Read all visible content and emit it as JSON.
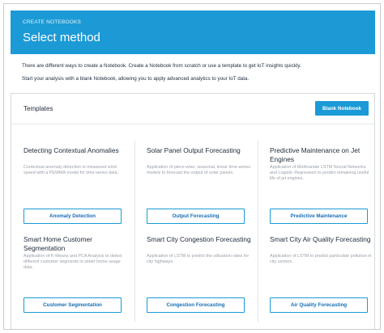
{
  "header": {
    "breadcrumb": "CREATE NOTEBOOKS",
    "title": "Select method"
  },
  "intro": {
    "line1": "There are different ways to create a Notebook. Create a Notebook from scratch or use a template to get IoT insights quickly.",
    "line2": "Start your analysis with a blank Notebook, allowing you to apply advanced analytics to your IoT data."
  },
  "templates": {
    "heading": "Templates",
    "blank_button": "Blank Notebook",
    "cards": [
      {
        "title": "Detecting Contextual Anomalies",
        "description": "Contextual anomaly detection in measured wind speed with a PEWMA model for time-series data.",
        "button": "Anomaly Detection"
      },
      {
        "title": "Solar Panel Output Forecasting",
        "description": "Application of piece-wise, seasonal, linear time-series models to forecast the output of solar panels.",
        "button": "Output Forecasting"
      },
      {
        "title": "Predictive Maintenance on Jet Engines",
        "description": "Application of Multivariate LSTM Neural Networks and Logistic Regression to predict remaining useful life of jet engines.",
        "button": "Predictive Maintenance"
      },
      {
        "title": "Smart Home Customer Segmentation",
        "description": "Application of K-Means and PCA Analysis to detect different customer segments in smart home usage data.",
        "button": "Customer Segmentation"
      },
      {
        "title": "Smart City Congestion Forecasting",
        "description": "Application of LSTM to predict the utilization rates for city highways.",
        "button": "Congestion Forecasting"
      },
      {
        "title": "Smart City Air Quality Forecasting",
        "description": "Application of LSTM to predict particulate pollution in city centers.",
        "button": "Air Quality Forecasting"
      }
    ]
  },
  "colors": {
    "accent": "#1b9ad6",
    "text": "#232f3e",
    "muted": "#9aa1aa"
  }
}
